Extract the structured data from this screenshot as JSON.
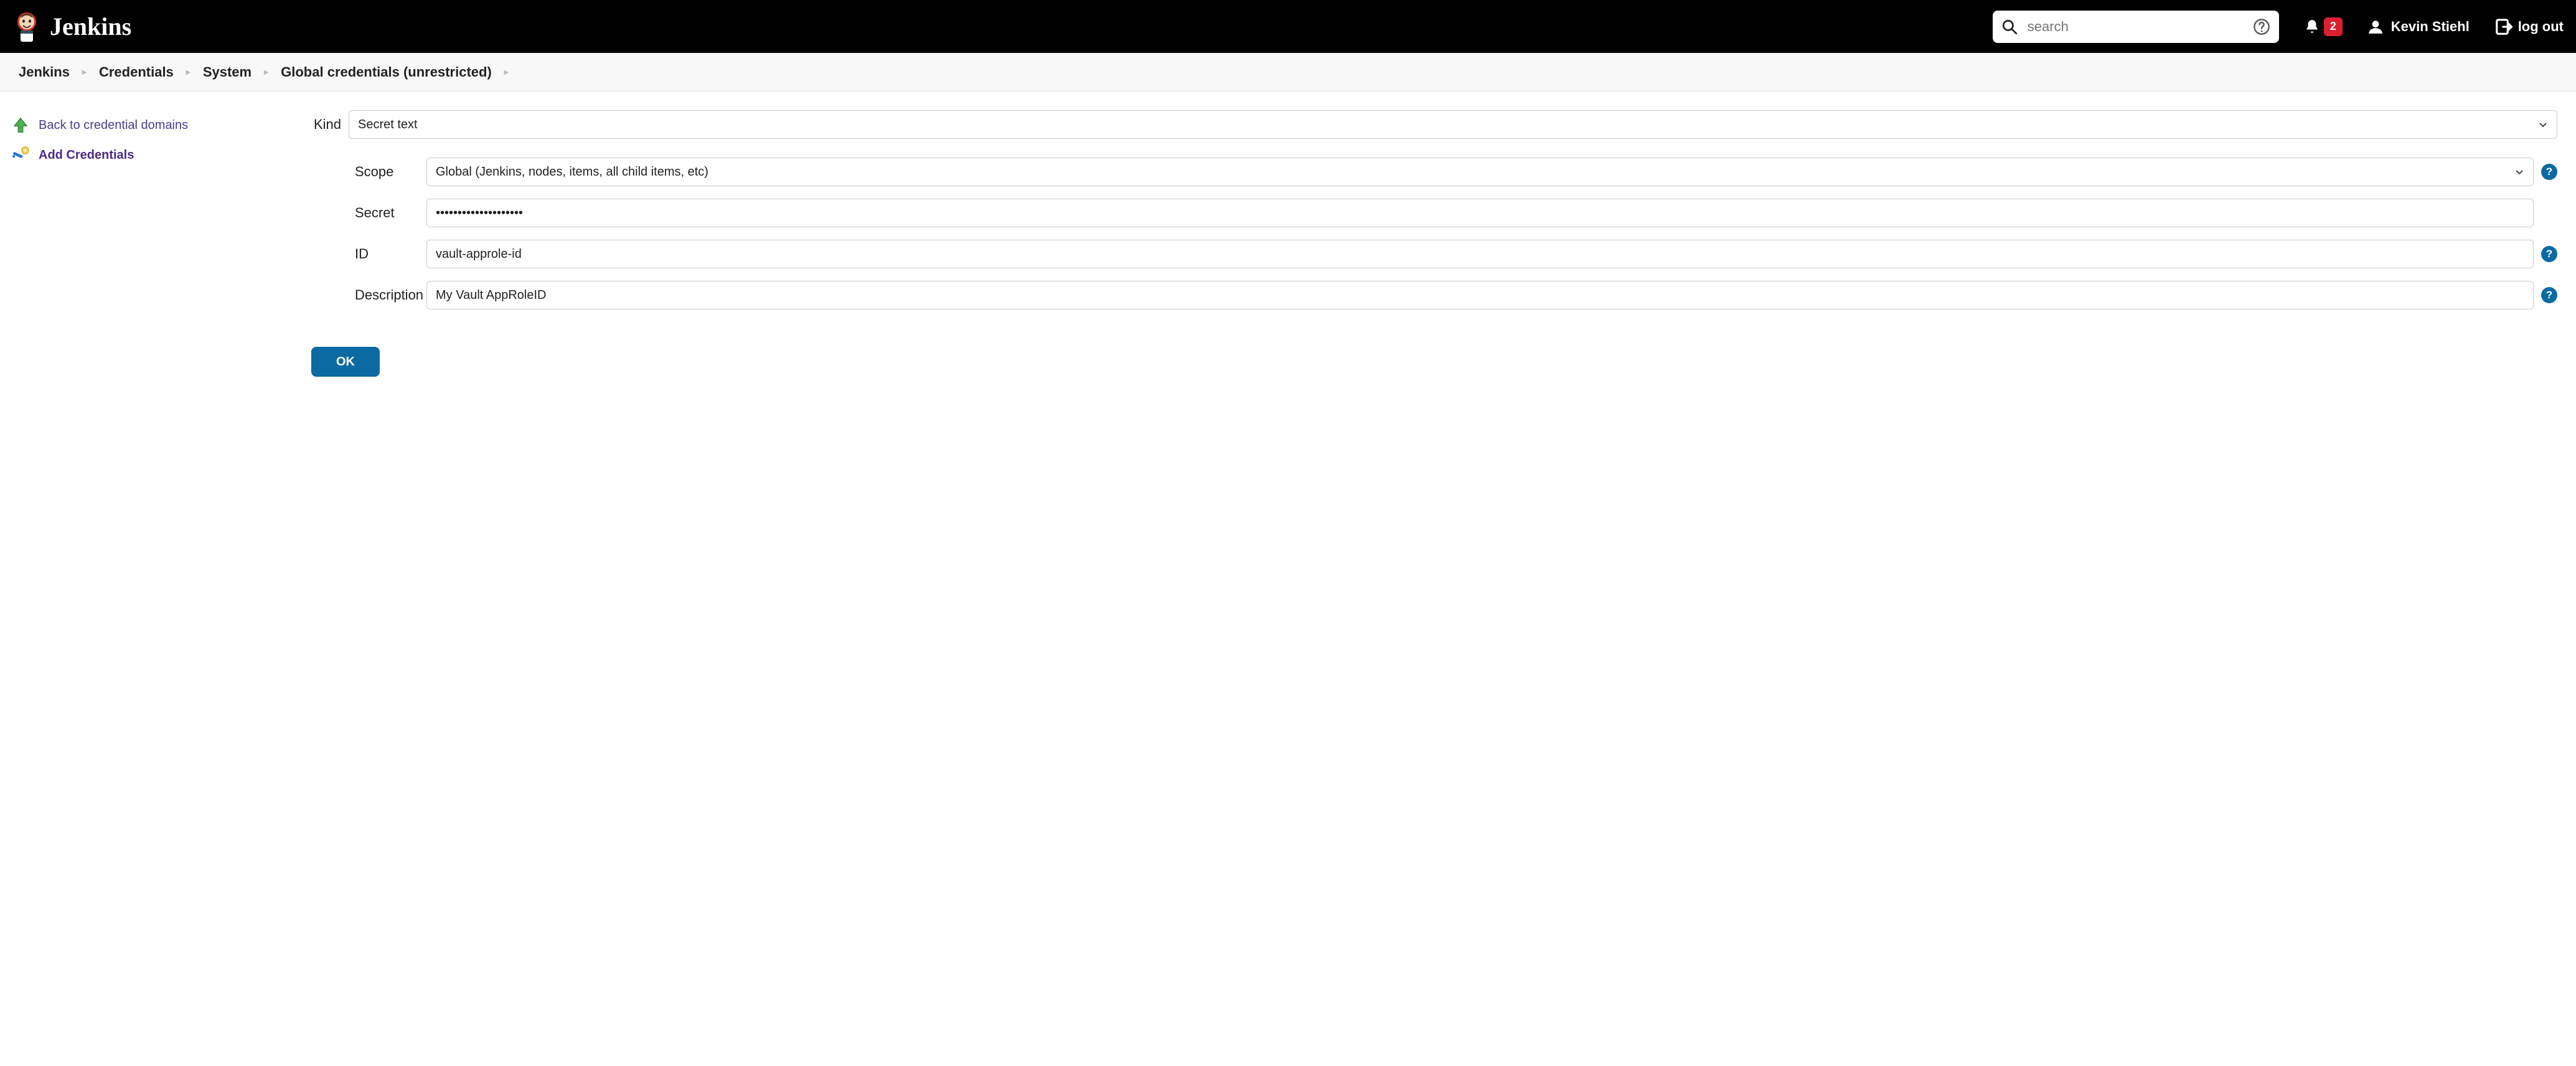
{
  "header": {
    "product": "Jenkins",
    "search_placeholder": "search",
    "notification_count": "2",
    "user_name": "Kevin Stiehl",
    "logout_label": "log out"
  },
  "breadcrumb": [
    "Jenkins",
    "Credentials",
    "System",
    "Global credentials (unrestricted)"
  ],
  "sidebar": {
    "back_label": "Back to credential domains",
    "add_label": "Add Credentials"
  },
  "form": {
    "kind_label": "Kind",
    "kind_value": "Secret text",
    "scope_label": "Scope",
    "scope_value": "Global (Jenkins, nodes, items, all child items, etc)",
    "secret_label": "Secret",
    "secret_value": "••••••••••••••••••••",
    "id_label": "ID",
    "id_value": "vault-approle-id",
    "description_label": "Description",
    "description_value": "My Vault AppRoleID",
    "submit_label": "OK"
  }
}
